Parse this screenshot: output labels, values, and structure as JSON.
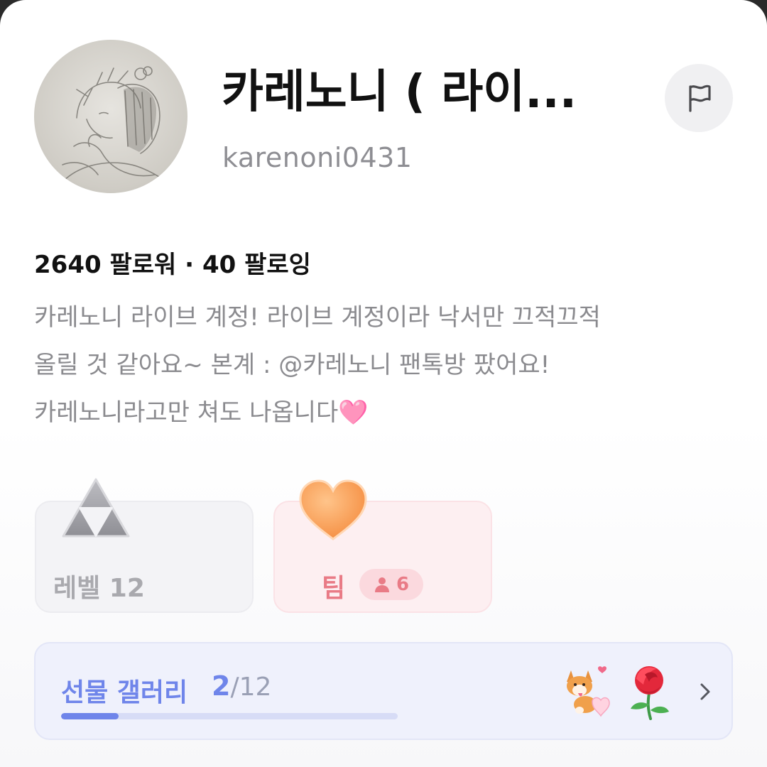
{
  "profile": {
    "display_name": "카레노니 ( 라이...",
    "handle": "karenoni0431"
  },
  "stats": {
    "followers_count": "2640",
    "followers_label": "팔로워",
    "separator": "·",
    "following_count": "40",
    "following_label": "팔로잉"
  },
  "bio": "카레노니 라이브 계정! 라이브 계정이라 낙서만 끄적끄적\n올릴 것 같아요~ 본계 : @카레노니  팬톡방 팠어요!\n카레노니라고만 쳐도 나옵니다🩷",
  "cards": {
    "level_label": "레벨 12",
    "team_label": "팀",
    "team_members": "6"
  },
  "gallery": {
    "title": "선물 갤러리",
    "current": "2",
    "total": "/12",
    "progress": 0.17
  },
  "icons": {
    "report": "flag-icon",
    "level": "triangle-level-icon",
    "team": "orange-heart-icon",
    "member": "person-icon",
    "gift1": "corgi-heart-gift-icon",
    "gift2": "rose-gift-icon",
    "chevron": "chevron-right-icon"
  },
  "colors": {
    "accent_blue": "#6f85ea",
    "team_pink": "#e97b86",
    "muted_gray": "#8e8e93"
  }
}
